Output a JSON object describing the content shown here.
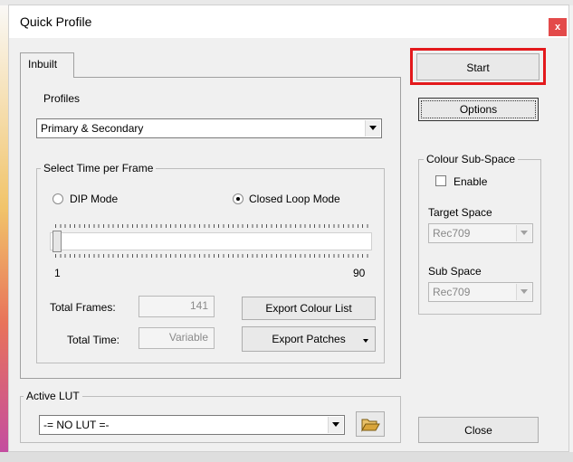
{
  "window": {
    "title": "Quick Profile",
    "close_label": "x"
  },
  "tabs": [
    {
      "label": "Inbuilt"
    }
  ],
  "profiles": {
    "label": "Profiles",
    "selected": "Primary & Secondary"
  },
  "frame_time": {
    "group_title": "Select Time per Frame",
    "modes": [
      {
        "label": "DIP Mode",
        "selected": false
      },
      {
        "label": "Closed Loop Mode",
        "selected": true
      }
    ],
    "slider": {
      "min_label": "1",
      "max_label": "90",
      "value": 1,
      "min": 1,
      "max": 90
    }
  },
  "stats": {
    "total_frames_label": "Total Frames:",
    "total_frames_value": "141",
    "total_time_label": "Total Time:",
    "total_time_value": "Variable"
  },
  "export": {
    "colour_list_label": "Export Colour List",
    "patches_label": "Export Patches"
  },
  "active_lut": {
    "group_title": "Active LUT",
    "selected": "-= NO LUT =-"
  },
  "sidebar": {
    "start_label": "Start",
    "options_label": "Options",
    "close_label": "Close",
    "colour_subspace": {
      "group_title": "Colour Sub-Space",
      "enable_label": "Enable",
      "enabled": false,
      "target_space_label": "Target Space",
      "target_space_value": "Rec709",
      "sub_space_label": "Sub Space",
      "sub_space_value": "Rec709"
    }
  },
  "colors": {
    "highlight": "#e3191c",
    "close_button": "#e34a4a",
    "folder_icon": "#d9a53a"
  }
}
